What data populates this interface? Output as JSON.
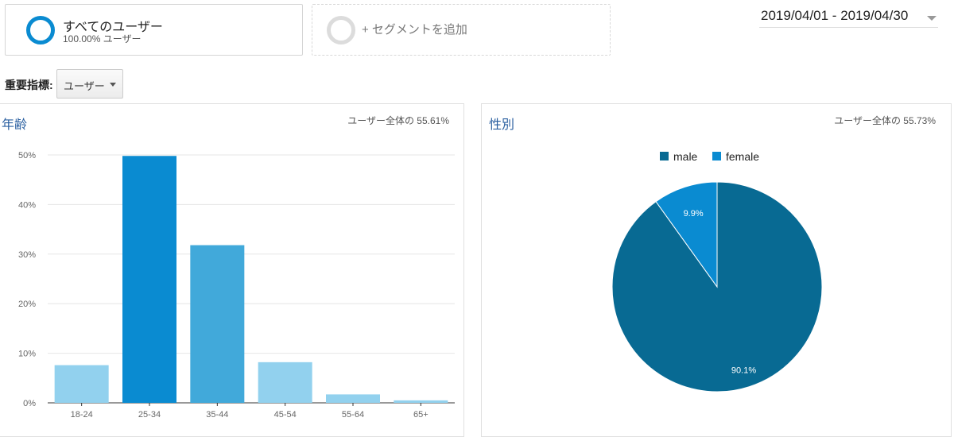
{
  "segments": {
    "active": {
      "title": "すべてのユーザー",
      "subtitle": "100.00% ユーザー"
    },
    "add": {
      "label": "+ セグメントを追加"
    }
  },
  "date_range": "2019/04/01 - 2019/04/30",
  "metric": {
    "label": "重要指標:",
    "selected": "ユーザー"
  },
  "age_panel": {
    "title": "年齢",
    "stat": "ユーザー全体の 55.61%"
  },
  "gender_panel": {
    "title": "性別",
    "stat": "ユーザー全体の 55.73%"
  },
  "colors": {
    "primary": "#0a8bd1",
    "bar_dark": "#0a8bd1",
    "bar_mid": "#41a9da",
    "bar_light": "#92d1ee",
    "male": "#086a93",
    "female": "#0a8bd1"
  },
  "chart_data": [
    {
      "type": "bar",
      "title": "年齢",
      "categories": [
        "18-24",
        "25-34",
        "35-44",
        "45-54",
        "55-64",
        "65+"
      ],
      "values": [
        7.6,
        49.8,
        31.8,
        8.2,
        1.7,
        0.5
      ],
      "bar_colors": [
        "#92d1ee",
        "#0a8bd1",
        "#41a9da",
        "#92d1ee",
        "#92d1ee",
        "#92d1ee"
      ],
      "yticks": [
        "0%",
        "10%",
        "20%",
        "30%",
        "40%",
        "50%"
      ],
      "ylim": [
        0,
        50
      ],
      "grid": true
    },
    {
      "type": "pie",
      "title": "性別",
      "labels": [
        "male",
        "female"
      ],
      "values": [
        90.1,
        9.9
      ],
      "value_labels": [
        "90.1%",
        "9.9%"
      ],
      "colors": [
        "#086a93",
        "#0a8bd1"
      ],
      "legend": "top"
    }
  ]
}
